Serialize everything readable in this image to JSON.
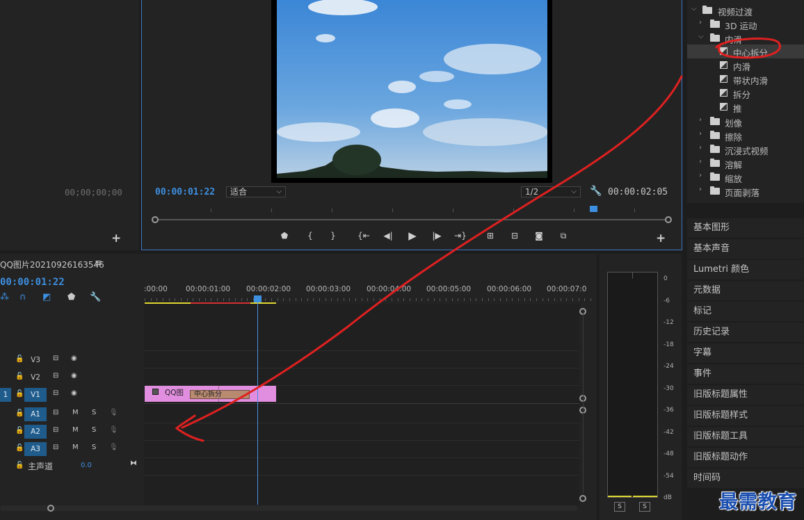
{
  "source_monitor": {
    "timecode": "00;00;00;00",
    "add_label": "+"
  },
  "program_monitor": {
    "timecode": "00:00:01:22",
    "fit_select": "适合",
    "resolution_select": "1/2",
    "duration": "00:00:02:05",
    "add_label": "+",
    "transport": [
      "marker-icon",
      "in-point-icon",
      "out-point-icon",
      "go-to-in-icon",
      "step-back-icon",
      "play-icon",
      "step-forward-icon",
      "go-to-out-icon",
      "lift-icon",
      "extract-icon",
      "camera-icon",
      "compare-icon"
    ]
  },
  "effects_tree": {
    "video_transitions": "视频过渡",
    "motion_3d": "3D 运动",
    "slide_folder": "内滑",
    "items": [
      "中心拆分",
      "内滑",
      "带状内滑",
      "拆分",
      "推"
    ],
    "folders": [
      "划像",
      "擦除",
      "沉浸式视频",
      "溶解",
      "缩放",
      "页面剥落"
    ]
  },
  "side_panels": [
    "基本图形",
    "基本声音",
    "Lumetri 颜色",
    "元数据",
    "标记",
    "历史记录",
    "字幕",
    "事件",
    "旧版标题属性",
    "旧版标题样式",
    "旧版标题工具",
    "旧版标题动作",
    "时间码"
  ],
  "timeline": {
    "sequence_name": "QQ图片20210926163546",
    "menu_icon": "≡",
    "timecode": "00:00:01:22",
    "ruler": [
      ":00:00",
      "00:00:01:00",
      "00:00:02:00",
      "00:00:03:00",
      "00:00:04:00",
      "00:00:05:00",
      "00:00:06:00",
      "00:00:07:0"
    ],
    "video_tracks": [
      "V3",
      "V2",
      "V1"
    ],
    "audio_tracks": [
      "A1",
      "A2",
      "A3"
    ],
    "track_buttons": {
      "mute": "M",
      "solo": "S"
    },
    "source_patch": "1",
    "master": {
      "label": "主声道",
      "value": "0.0"
    },
    "clip_name": "QQ图",
    "transition_name": "中心拆分"
  },
  "audio_meter": {
    "db_scale": [
      "0",
      "-6",
      "-12",
      "-18",
      "-24",
      "-30",
      "-36",
      "-42",
      "-48",
      "-54",
      "dB"
    ],
    "solo": [
      "S",
      "S"
    ]
  },
  "watermark": "最需教育",
  "colors": {
    "accent": "#3d8fe0",
    "clip": "#e28ee0",
    "annotation": "#e02020"
  }
}
